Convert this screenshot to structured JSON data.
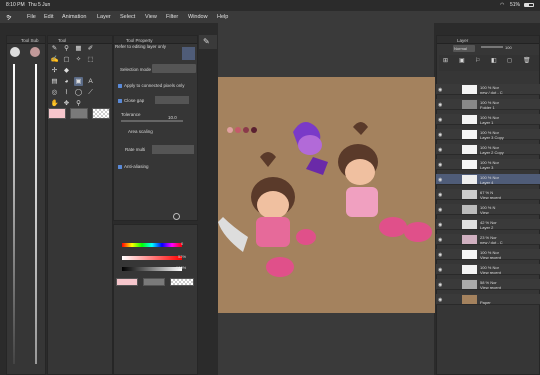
{
  "status": {
    "time": "8:10 PM",
    "date": "Thu 5 Jun",
    "battery_text": "51%",
    "battery_level": 0.51
  },
  "menu": {
    "items": [
      "File",
      "Edit",
      "Animation",
      "Layer",
      "Select",
      "View",
      "Filter",
      "Window",
      "Help"
    ]
  },
  "panels": {
    "tool_sub": "Tool Sub",
    "tool": "Tool",
    "tool_property": "Tool Property",
    "layer": "Layer"
  },
  "tool_property": {
    "refer_label": "Refer to editing layer only",
    "selection_mode_label": "Selection mode",
    "apply_connected": "Apply to connected pixels only",
    "close_gap": "Close gap",
    "tolerance_label": "Tolerance",
    "tolerance_value": "10.0",
    "area_scaling": "Area scaling",
    "rate_label": "Rate multi",
    "anti_aliasing": "Anti-aliasing"
  },
  "color": {
    "h": "0",
    "s": "52%",
    "v": "100%",
    "main_color": "#f6c6cc"
  },
  "layer_panel": {
    "blend": "Normal",
    "opacity": "100"
  },
  "layers": [
    {
      "pct": "100 % Nor",
      "name": "new / dot - C",
      "thumb": "#f4f4f4",
      "selected": false
    },
    {
      "pct": "100 % Nor",
      "name": "Folder 1",
      "thumb": "#888",
      "selected": false
    },
    {
      "pct": "100 % Nor",
      "name": "Layer 1",
      "thumb": "#f4f4f4",
      "selected": false
    },
    {
      "pct": "100 % Nor",
      "name": "Layer 3 Copy",
      "thumb": "#f4f4f4",
      "selected": false
    },
    {
      "pct": "100 % Nor",
      "name": "Layer 2 Copy",
      "thumb": "#f4f4f4",
      "selected": false
    },
    {
      "pct": "100 % Nor",
      "name": "Layer 3",
      "thumb": "#f4f4f4",
      "selected": false
    },
    {
      "pct": "100 % Nor",
      "name": "Layer 4",
      "thumb": "#eee",
      "selected": true
    },
    {
      "pct": "67 % N",
      "name": "View recent",
      "thumb": "#ccc",
      "selected": false
    },
    {
      "pct": "100 % N",
      "name": "View",
      "thumb": "#bbb",
      "selected": false
    },
    {
      "pct": "42 % Nor",
      "name": "Layer 2",
      "thumb": "#e0e0e0",
      "selected": false
    },
    {
      "pct": "23 % Nor",
      "name": "new / dot - C",
      "thumb": "#d0b0c0",
      "selected": false
    },
    {
      "pct": "100 % Nor",
      "name": "View recent",
      "thumb": "#f4f4f4",
      "selected": false
    },
    {
      "pct": "100 % Nor",
      "name": "View recent",
      "thumb": "#f4f4f4",
      "selected": false
    },
    {
      "pct": "58 % Nor",
      "name": "View recent",
      "thumb": "#aaa",
      "selected": false
    },
    {
      "pct": "",
      "name": "Paper",
      "thumb": "#a4825e",
      "selected": false
    }
  ]
}
